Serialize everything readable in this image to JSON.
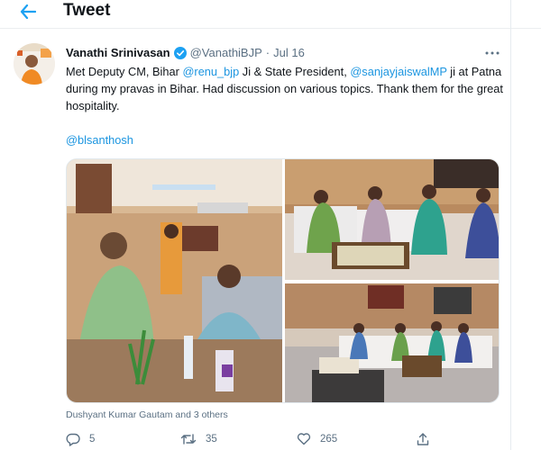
{
  "header": {
    "title": "Tweet"
  },
  "tweet": {
    "author_name": "Vanathi Srinivasan",
    "handle": "@VanathiBJP",
    "separator": "·",
    "date": "Jul 16",
    "text": {
      "p1": "Met Deputy CM, Bihar ",
      "m1": "@renu_bjp",
      "p2": " Ji & State President, ",
      "m2": "@sanjayjaiswalMP",
      "p3": " ji at Patna during my pravas in Bihar. Had discussion on various topics. Thank them for the great hospitality."
    },
    "mention_line": "@blsanthosh",
    "tagged_people": "Dushyant Kumar Gautam and 3 others",
    "counts": {
      "replies": "5",
      "retweets": "35",
      "likes": "265"
    }
  },
  "icons": {
    "back": "back-arrow-icon",
    "verified": "verified-badge-icon",
    "more": "more-options-icon",
    "reply": "reply-icon",
    "retweet": "retweet-icon",
    "like": "like-icon",
    "share": "share-icon"
  },
  "colors": {
    "accent": "#1da1f2",
    "link": "#1b95e0",
    "muted": "#5b7083"
  }
}
